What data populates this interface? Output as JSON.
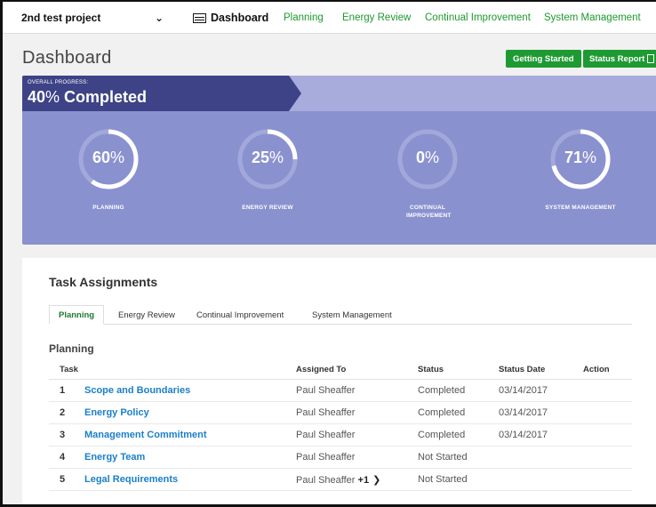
{
  "nav": {
    "project": "2nd test project",
    "links": [
      {
        "label": "Dashboard",
        "active": true
      },
      {
        "label": "Planning"
      },
      {
        "label": "Energy Review"
      },
      {
        "label": "Continual Improvement"
      },
      {
        "label": "System Management"
      }
    ]
  },
  "header": {
    "title": "Dashboard",
    "getting_started": "Getting Started",
    "status_report": "Status Report"
  },
  "progress": {
    "overall_label": "OVERALL PROGRESS:",
    "overall_value": "40",
    "overall_pct": "%",
    "overall_suffix": " Completed",
    "gauges": [
      {
        "value": "60",
        "pct": "%",
        "fraction": 0.6,
        "label": "PLANNING"
      },
      {
        "value": "25",
        "pct": "%",
        "fraction": 0.25,
        "label": "ENERGY REVIEW"
      },
      {
        "value": "0",
        "pct": "%",
        "fraction": 0.0,
        "label": "CONTINUAL IMPROVEMENT"
      },
      {
        "value": "71",
        "pct": "%",
        "fraction": 0.71,
        "label": "SYSTEM MANAGEMENT"
      }
    ]
  },
  "tasks": {
    "title": "Task Assignments",
    "tabs": [
      "Planning",
      "Energy Review",
      "Continual Improvement",
      "System Management"
    ],
    "section_title": "Planning",
    "columns": [
      "Task",
      "Assigned To",
      "Status",
      "Status Date",
      "Action"
    ],
    "rows": [
      {
        "num": "1",
        "task": "Scope and Boundaries",
        "assigned": "Paul Sheaffer",
        "status": "Completed",
        "date": "03/14/2017"
      },
      {
        "num": "2",
        "task": "Energy Policy",
        "assigned": "Paul Sheaffer",
        "status": "Completed",
        "date": "03/14/2017"
      },
      {
        "num": "3",
        "task": "Management Commitment",
        "assigned": "Paul Sheaffer",
        "status": "Completed",
        "date": "03/14/2017"
      },
      {
        "num": "4",
        "task": "Energy Team",
        "assigned": "Paul Sheaffer",
        "status": "Not Started",
        "date": ""
      },
      {
        "num": "5",
        "task": "Legal Requirements",
        "assigned": "Paul Sheaffer",
        "extra": "+1",
        "status": "Not Started",
        "date": ""
      }
    ]
  },
  "colors": {
    "accent_green": "#1e9a33",
    "panel": "#8a91cf",
    "panel_dark": "#3d4386",
    "link_blue": "#1a7fc8"
  },
  "icons": [
    "chevron-down-icon",
    "dashboard-icon",
    "pdf-icon",
    "chevron-right-icon"
  ]
}
